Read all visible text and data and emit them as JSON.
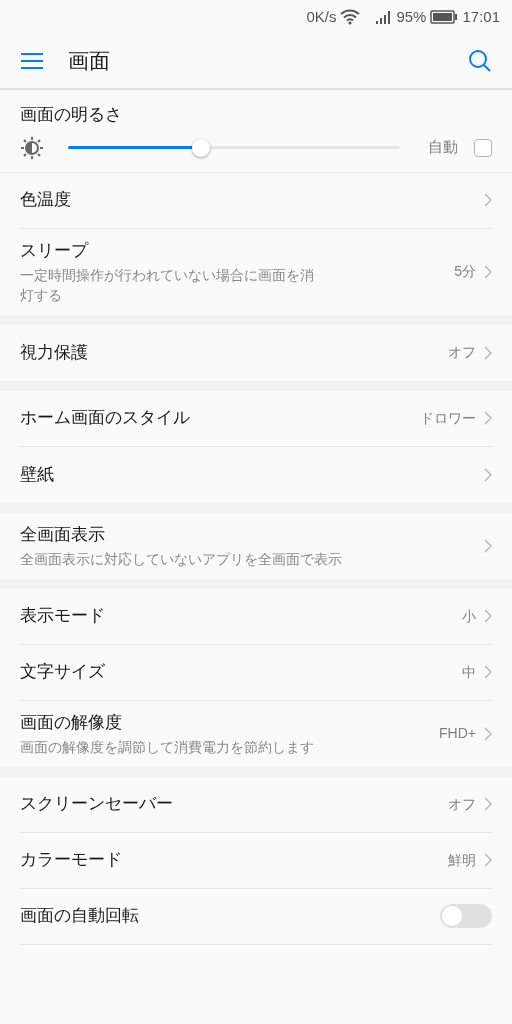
{
  "status_bar": {
    "speed": "0K/s",
    "battery": "95%",
    "time": "17:01"
  },
  "header": {
    "title": "画面"
  },
  "groups": [
    {
      "items": [
        {
          "kind": "slider",
          "title": "画面の明るさ",
          "level": 0.4,
          "auto_label": "自動",
          "auto_checked": false
        },
        {
          "kind": "link",
          "title": "色温度"
        },
        {
          "kind": "link",
          "title": "スリープ",
          "subtitle": "一定時間操作が行われていない場合に画面を消灯する",
          "value": "5分"
        }
      ]
    },
    {
      "items": [
        {
          "kind": "link",
          "title": "視力保護",
          "value": "オフ"
        }
      ]
    },
    {
      "items": [
        {
          "kind": "link",
          "title": "ホーム画面のスタイル",
          "value": "ドロワー"
        },
        {
          "kind": "link",
          "title": "壁紙"
        }
      ]
    },
    {
      "items": [
        {
          "kind": "link",
          "title": "全画面表示",
          "subtitle": "全画面表示に対応していないアプリを全画面で表示"
        }
      ]
    },
    {
      "items": [
        {
          "kind": "link",
          "title": "表示モード",
          "value": "小"
        },
        {
          "kind": "link",
          "title": "文字サイズ",
          "value": "中"
        },
        {
          "kind": "link",
          "title": "画面の解像度",
          "subtitle": "画面の解像度を調節して消費電力を節約します",
          "value": "FHD+"
        }
      ]
    },
    {
      "items": [
        {
          "kind": "link",
          "title": "スクリーンセーバー",
          "value": "オフ"
        },
        {
          "kind": "link",
          "title": "カラーモード",
          "value": "鮮明"
        },
        {
          "kind": "toggle",
          "title": "画面の自動回転",
          "on": false
        }
      ]
    }
  ]
}
